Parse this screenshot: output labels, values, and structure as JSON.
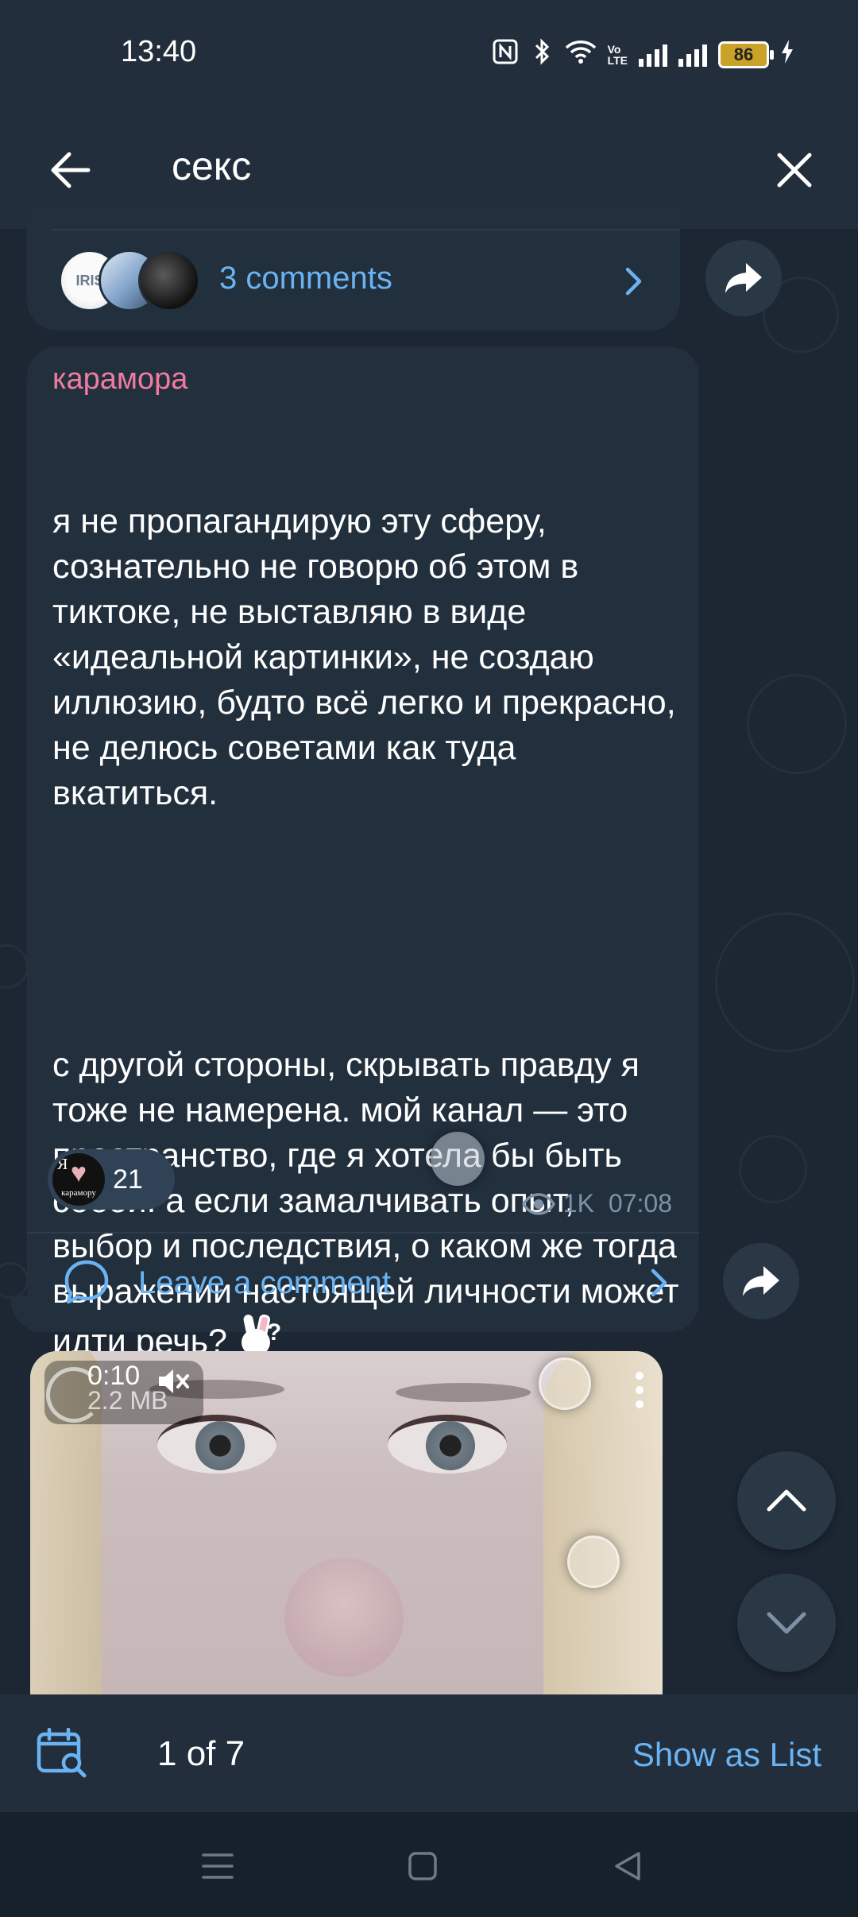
{
  "status_bar": {
    "time": "13:40",
    "volte_label": "Vo\nLTE",
    "battery_level": "86"
  },
  "header": {
    "search_query": "секс"
  },
  "post_previous": {
    "comments_label": "3 comments",
    "avatar_first_label": "IRIS"
  },
  "message": {
    "author": "карамора",
    "paragraph_1": "я не пропагандирую эту сферу, сознательно не говорю об этом в тиктоке, не выставляю в виде «идеальной картинки», не создаю иллюзию, будто всё легко и прекрасно, не делюсь советами как туда вкатиться.",
    "paragraph_2": "с другой стороны, скрывать правду я тоже не намерена. мой канал — это пространство, где я хотела бы быть собой. а если замалчивать опыт, выбор и последствия, о каком же тогда выражении настоящей личности может идти речь?",
    "reaction_image_text_line1": "Я",
    "reaction_image_text_line2": "карамору",
    "reaction_count": "21",
    "views": "1K",
    "time": "07:08",
    "leave_comment_label": "Leave a comment"
  },
  "video": {
    "duration": "0:10",
    "size": "2.2 MB"
  },
  "bottom_bar": {
    "counter": "1 of 7",
    "show_as_list_label": "Show as List"
  },
  "colors": {
    "accent": "#6ab3f3",
    "author_name": "#f07ba0",
    "bubble": "#222f3d",
    "bar": "#232e3c"
  }
}
